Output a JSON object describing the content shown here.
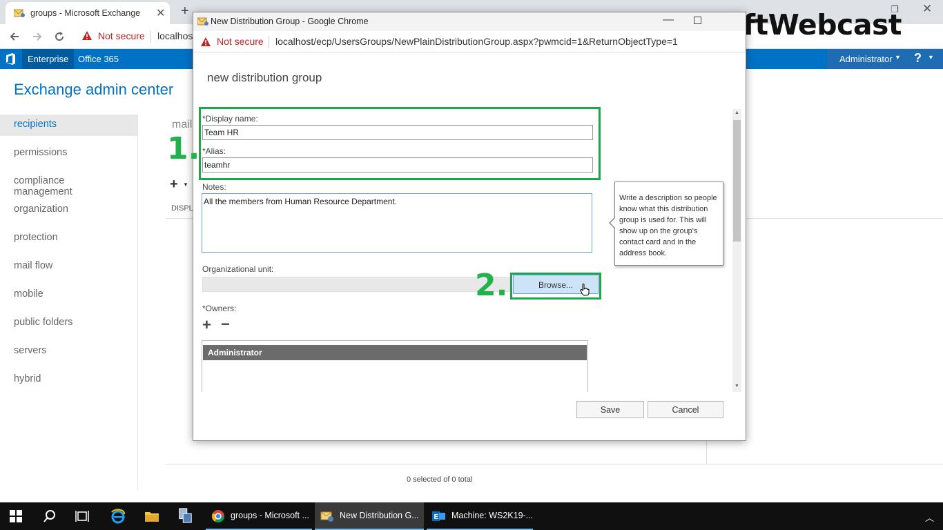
{
  "browser": {
    "tab_title": "groups - Microsoft Exchange",
    "tab_close": "✕",
    "new_tab": "+",
    "not_secure": "Not secure",
    "url_partial": "localhost"
  },
  "ecp": {
    "nav_enterprise": "Enterprise",
    "nav_office365": "Office 365",
    "admin_label": "Administrator",
    "help_label": "?",
    "title": "Exchange admin center",
    "left_nav": [
      "recipients",
      "permissions",
      "compliance management",
      "organization",
      "protection",
      "mail flow",
      "mobile",
      "public folders",
      "servers",
      "hybrid"
    ],
    "page_heading_partial": "mail",
    "column_header_partial": "DISPLA",
    "status": "0 selected of 0 total"
  },
  "popup": {
    "window_title": "New Distribution Group - Google Chrome",
    "not_secure": "Not secure",
    "url": "localhost/ecp/UsersGroups/NewPlainDistributionGroup.aspx?pwmcid=1&ReturnObjectType=1",
    "dialog_title": "new distribution group",
    "display_name_label": "*Display name:",
    "display_name_value": "Team HR",
    "alias_label": "*Alias:",
    "alias_value": "teamhr",
    "notes_label": "Notes:",
    "notes_value": "All the members from Human Resource Department.",
    "ou_label": "Organizational unit:",
    "browse_label": "Browse...",
    "owners_label": "*Owners:",
    "owners": [
      "Administrator"
    ],
    "tooltip": "Write a description so people know what this distribution group is used for. This will show up on the group's contact card and in the address book.",
    "save_label": "Save",
    "cancel_label": "Cancel"
  },
  "annotations": {
    "step1": "1.",
    "step2": "2.",
    "watermark": "MsftWebcast"
  },
  "taskbar": {
    "apps": [
      {
        "label": "groups - Microsoft ...",
        "icon": "chrome-icon"
      },
      {
        "label": "New Distribution G...",
        "icon": "exchange-app-icon"
      },
      {
        "label": "Machine: WS2K19-...",
        "icon": "exchange-machine-icon"
      }
    ]
  },
  "colors": {
    "ecp_blue": "#0072c6",
    "highlight_green": "#1aa84a",
    "not_secure_red": "#c5221f",
    "browse_blue": "#cde4f7"
  }
}
